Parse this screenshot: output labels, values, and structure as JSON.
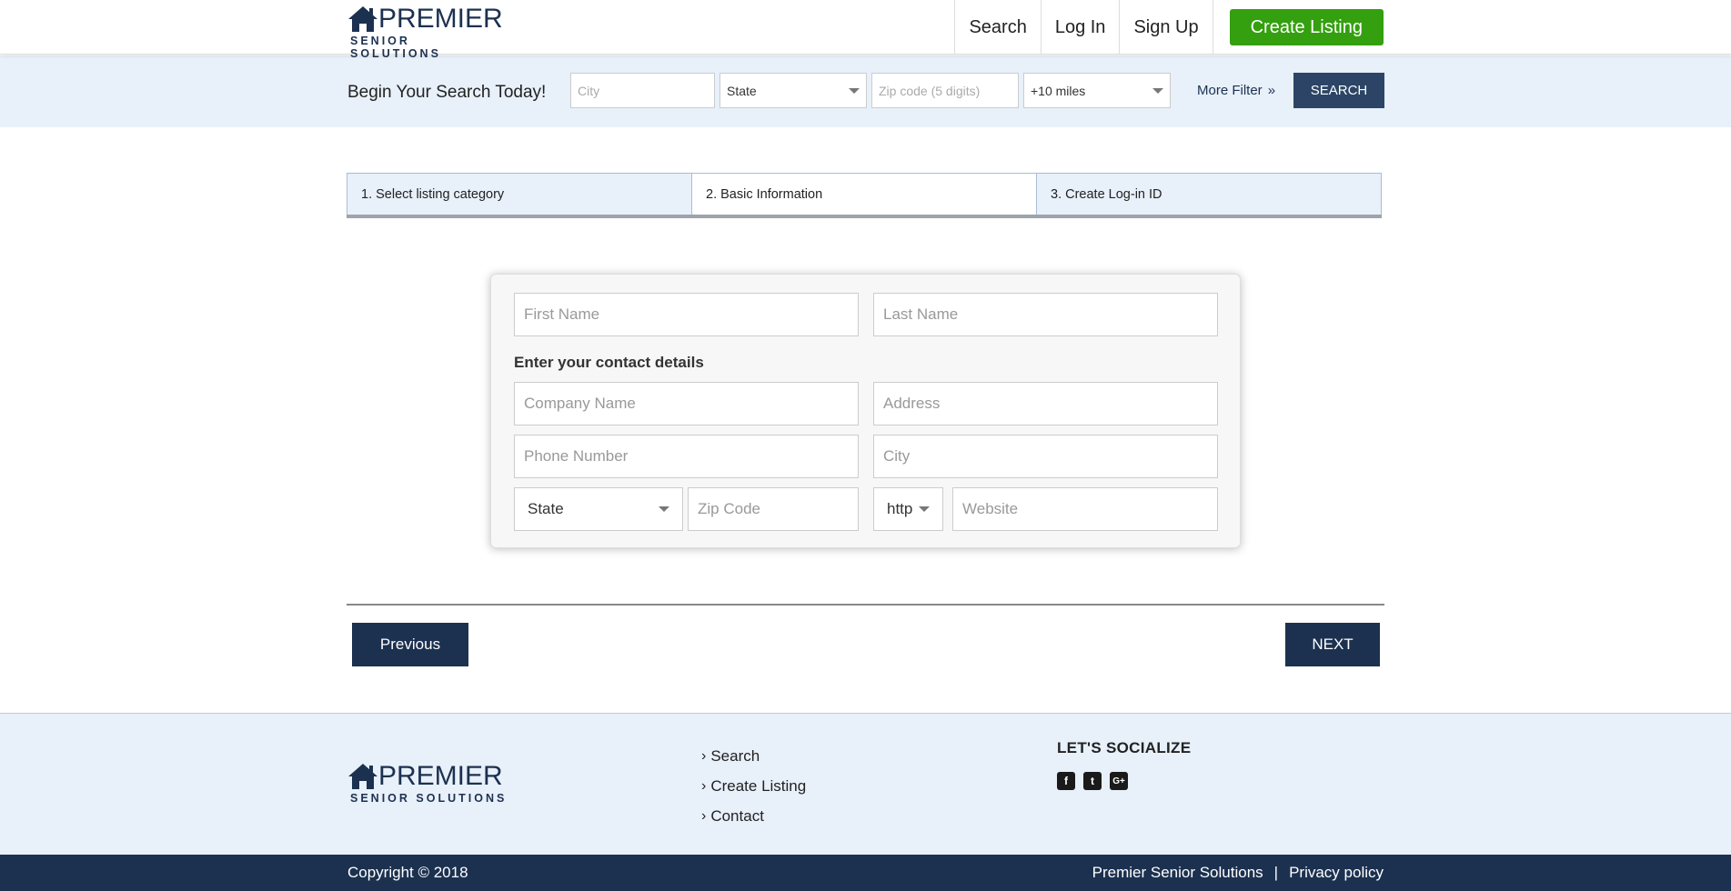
{
  "header": {
    "logo_word": "PREMIER",
    "logo_sub": "SENIOR SOLUTIONS",
    "nav": [
      "Search",
      "Log In",
      "Sign Up"
    ],
    "create_listing": "Create Listing"
  },
  "searchbar": {
    "title": "Begin Your Search Today!",
    "city_placeholder": "City",
    "state_value": "State",
    "zip_placeholder": "Zip code (5 digits)",
    "radius_value": "+10 miles",
    "more_filter": "More Filter",
    "more_filter_icon": "double-chevron-right-icon",
    "search_button": "SEARCH"
  },
  "steps": [
    {
      "label": "1. Select listing category"
    },
    {
      "label": "2. Basic Information"
    },
    {
      "label": "3. Create Log-in ID"
    }
  ],
  "form": {
    "first_name": "First Name",
    "last_name": "Last Name",
    "contact_label": "Enter your contact details",
    "company": "Company Name",
    "address": "Address",
    "phone": "Phone Number",
    "city": "City",
    "state": "State",
    "zip": "Zip Code",
    "protocol": "http",
    "website": "Website"
  },
  "nav_buttons": {
    "previous": "Previous",
    "next": "NEXT"
  },
  "footer": {
    "links": [
      "Search",
      "Create Listing",
      "Contact"
    ],
    "social_title": "LET'S SOCIALIZE",
    "social_icons": [
      "facebook-icon",
      "twitter-icon",
      "google-plus-icon"
    ],
    "copyright": "Copyright © 2018",
    "company": "Premier Senior Solutions",
    "separator": "|",
    "privacy": "Privacy policy"
  },
  "colors": {
    "brand_navy": "#1c3150",
    "accent_green": "#34a00f",
    "light_blue_bg": "#e8f0fa"
  }
}
